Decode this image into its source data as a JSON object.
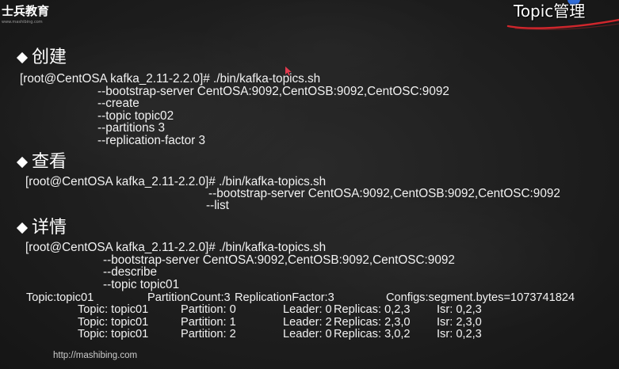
{
  "logo": {
    "name": "士兵教育",
    "subtext": "www.mashibing.com"
  },
  "header": {
    "title": "Topic管理"
  },
  "sections": [
    {
      "heading": "创建",
      "command": "[root@CentOSA kafka_2.11-2.2.0]# ./bin/kafka-topics.sh",
      "args": [
        "--bootstrap-server CentOSA:9092,CentOSB:9092,CentOSC:9092",
        "--create",
        "--topic topic02",
        "--partitions 3",
        "--replication-factor 3"
      ]
    },
    {
      "heading": "查看",
      "command": "[root@CentOSA kafka_2.11-2.2.0]# ./bin/kafka-topics.sh",
      "args": [
        "--bootstrap-server CentOSA:9092,CentOSB:9092,CentOSC:9092",
        "--list"
      ]
    },
    {
      "heading": "详情",
      "command": "[root@CentOSA kafka_2.11-2.2.0]# ./bin/kafka-topics.sh",
      "args": [
        "--bootstrap-server CentOSA:9092,CentOSB:9092,CentOSC:9092",
        "--describe",
        "--topic topic01"
      ]
    }
  ],
  "describe_output": {
    "summary": {
      "topic": "Topic:topic01",
      "partition_count": "PartitionCount:3",
      "replication_factor": "ReplicationFactor:3",
      "configs": "Configs:segment.bytes=1073741824"
    },
    "partitions": [
      {
        "topic": "Topic: topic01",
        "partition": "Partition: 0",
        "leader": "Leader: 0",
        "replicas": "Replicas: 0,2,3",
        "isr": "Isr: 0,2,3"
      },
      {
        "topic": "Topic: topic01",
        "partition": "Partition: 1",
        "leader": "Leader: 2",
        "replicas": "Replicas: 2,3,0",
        "isr": "Isr: 2,3,0"
      },
      {
        "topic": "Topic: topic01",
        "partition": "Partition: 2",
        "leader": "Leader: 0",
        "replicas": "Replicas: 3,0,2",
        "isr": "Isr: 0,2,3"
      }
    ]
  },
  "footer": {
    "url": "http://mashibing.com"
  },
  "icons": {
    "section_bullet": "diamond-bullet-icon",
    "cursor": "mouse-pointer-icon",
    "title_underline": "red-underline-stroke",
    "title_decoration": "blue-circle-mark"
  },
  "colors": {
    "background": "#1e1e1e",
    "text": "#f2f2f2",
    "footer_text": "#cccccc",
    "underline": "#d0262c",
    "cursor": "#e23a4e",
    "decoration_blue": "#2e6bd8"
  }
}
